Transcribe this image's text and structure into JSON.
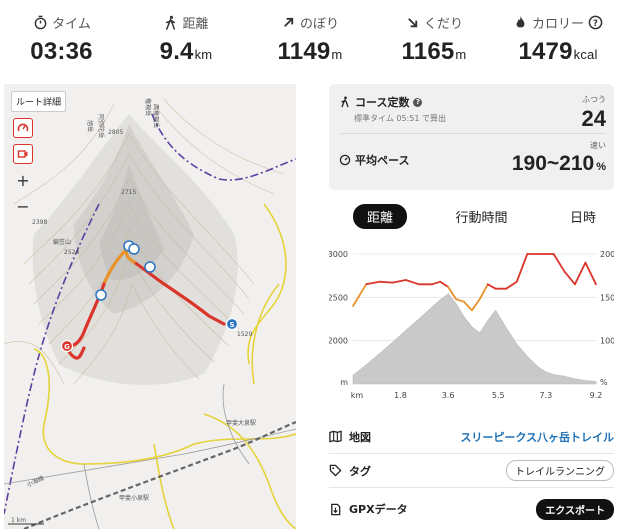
{
  "stats": [
    {
      "label": "タイム",
      "value": "03:36",
      "unit": "",
      "icon": "stopwatch-icon"
    },
    {
      "label": "距離",
      "value": "9.4",
      "unit": "km",
      "icon": "walker-icon"
    },
    {
      "label": "のぼり",
      "value": "1149",
      "unit": "m",
      "icon": "arrow-up-right-icon"
    },
    {
      "label": "くだり",
      "value": "1165",
      "unit": "m",
      "icon": "arrow-down-right-icon"
    },
    {
      "label": "カロリー",
      "value": "1479",
      "unit": "kcal",
      "icon": "flame-icon"
    }
  ],
  "map": {
    "route_detail_label": "ルート詳細",
    "zoom_in": "+",
    "zoom_out": "−",
    "place_labels": {
      "gonge": "権現岳",
      "nishigon": "西権現岳",
      "amidadake": "阿弥陀岳",
      "kiboko": "旭岳",
      "kabutoyama": "編笠山",
      "kabutoyama_elev": "2524",
      "elev_2805": "2805",
      "elev_2398": "2398",
      "elev_2715": "2715",
      "elev_1529": "1529",
      "kaimi_station": "甲斐大泉駅",
      "kaimi_station2": "甲斐小泉駅",
      "kobuchi": "小海線",
      "scale": "1 km"
    }
  },
  "summary": {
    "course_label": "コース定数",
    "course_sub": "標準タイム 05:51 で算出",
    "course_level": "ふつう",
    "course_value": "24",
    "pace_label": "平均ペース",
    "pace_level": "速い",
    "pace_value": "190~210",
    "pace_unit": "%"
  },
  "tabs": [
    "距離",
    "行動時間",
    "日時"
  ],
  "chart_data": {
    "type": "area",
    "x": [
      0,
      0.5,
      1.0,
      1.5,
      2.0,
      2.5,
      3.0,
      3.3,
      3.6,
      3.9,
      4.2,
      4.5,
      4.8,
      5.1,
      5.4,
      5.8,
      6.2,
      6.6,
      7.0,
      7.3,
      7.6,
      8.0,
      8.4,
      8.8,
      9.2
    ],
    "series": [
      {
        "values": [
          1600,
          1720,
          1850,
          1980,
          2120,
          2250,
          2390,
          2470,
          2540,
          2430,
          2280,
          2160,
          2090,
          2230,
          2350,
          2150,
          1960,
          1820,
          1700,
          1640,
          1610,
          1590,
          1560,
          1540,
          1530
        ]
      },
      {
        "values": [
          140,
          165,
          168,
          167,
          170,
          165,
          165,
          168,
          162,
          148,
          145,
          135,
          148,
          165,
          160,
          160,
          168,
          200,
          200,
          200,
          200,
          180,
          165,
          190,
          165
        ]
      }
    ],
    "xlabel": "km",
    "ylabel_left": "m",
    "ylabel_right": "%",
    "xticks": [
      "1.8",
      "3.6",
      "5.5",
      "7.3",
      "9.2"
    ],
    "yticks_left": [
      "2000",
      "2500",
      "3000"
    ],
    "yticks_right": [
      "100",
      "150",
      "200"
    ],
    "ylim_left": [
      1500,
      3000
    ],
    "ylim_right": [
      50,
      200
    ],
    "xlim": [
      0,
      9.2
    ]
  },
  "info": {
    "map_label": "地図",
    "map_value": "スリーピークス八ヶ岳トレイル",
    "tag_label": "タグ",
    "tag_value": "トレイルランニング",
    "gpx_label": "GPXデータ",
    "gpx_button": "エクスポート"
  },
  "colors": {
    "route_red": "#d9352b",
    "route_orange": "#e8922a",
    "accent": "#1a6fb5"
  }
}
